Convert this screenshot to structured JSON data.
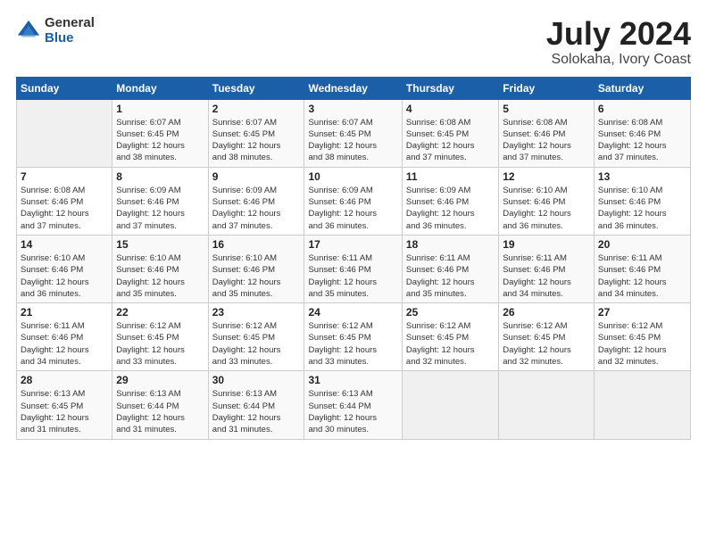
{
  "logo": {
    "general": "General",
    "blue": "Blue"
  },
  "header": {
    "title": "July 2024",
    "subtitle": "Solokaha, Ivory Coast"
  },
  "days_of_week": [
    "Sunday",
    "Monday",
    "Tuesday",
    "Wednesday",
    "Thursday",
    "Friday",
    "Saturday"
  ],
  "weeks": [
    [
      {
        "day": "",
        "info": ""
      },
      {
        "day": "1",
        "info": "Sunrise: 6:07 AM\nSunset: 6:45 PM\nDaylight: 12 hours\nand 38 minutes."
      },
      {
        "day": "2",
        "info": "Sunrise: 6:07 AM\nSunset: 6:45 PM\nDaylight: 12 hours\nand 38 minutes."
      },
      {
        "day": "3",
        "info": "Sunrise: 6:07 AM\nSunset: 6:45 PM\nDaylight: 12 hours\nand 38 minutes."
      },
      {
        "day": "4",
        "info": "Sunrise: 6:08 AM\nSunset: 6:45 PM\nDaylight: 12 hours\nand 37 minutes."
      },
      {
        "day": "5",
        "info": "Sunrise: 6:08 AM\nSunset: 6:46 PM\nDaylight: 12 hours\nand 37 minutes."
      },
      {
        "day": "6",
        "info": "Sunrise: 6:08 AM\nSunset: 6:46 PM\nDaylight: 12 hours\nand 37 minutes."
      }
    ],
    [
      {
        "day": "7",
        "info": "Sunrise: 6:08 AM\nSunset: 6:46 PM\nDaylight: 12 hours\nand 37 minutes."
      },
      {
        "day": "8",
        "info": "Sunrise: 6:09 AM\nSunset: 6:46 PM\nDaylight: 12 hours\nand 37 minutes."
      },
      {
        "day": "9",
        "info": "Sunrise: 6:09 AM\nSunset: 6:46 PM\nDaylight: 12 hours\nand 37 minutes."
      },
      {
        "day": "10",
        "info": "Sunrise: 6:09 AM\nSunset: 6:46 PM\nDaylight: 12 hours\nand 36 minutes."
      },
      {
        "day": "11",
        "info": "Sunrise: 6:09 AM\nSunset: 6:46 PM\nDaylight: 12 hours\nand 36 minutes."
      },
      {
        "day": "12",
        "info": "Sunrise: 6:10 AM\nSunset: 6:46 PM\nDaylight: 12 hours\nand 36 minutes."
      },
      {
        "day": "13",
        "info": "Sunrise: 6:10 AM\nSunset: 6:46 PM\nDaylight: 12 hours\nand 36 minutes."
      }
    ],
    [
      {
        "day": "14",
        "info": "Sunrise: 6:10 AM\nSunset: 6:46 PM\nDaylight: 12 hours\nand 36 minutes."
      },
      {
        "day": "15",
        "info": "Sunrise: 6:10 AM\nSunset: 6:46 PM\nDaylight: 12 hours\nand 35 minutes."
      },
      {
        "day": "16",
        "info": "Sunrise: 6:10 AM\nSunset: 6:46 PM\nDaylight: 12 hours\nand 35 minutes."
      },
      {
        "day": "17",
        "info": "Sunrise: 6:11 AM\nSunset: 6:46 PM\nDaylight: 12 hours\nand 35 minutes."
      },
      {
        "day": "18",
        "info": "Sunrise: 6:11 AM\nSunset: 6:46 PM\nDaylight: 12 hours\nand 35 minutes."
      },
      {
        "day": "19",
        "info": "Sunrise: 6:11 AM\nSunset: 6:46 PM\nDaylight: 12 hours\nand 34 minutes."
      },
      {
        "day": "20",
        "info": "Sunrise: 6:11 AM\nSunset: 6:46 PM\nDaylight: 12 hours\nand 34 minutes."
      }
    ],
    [
      {
        "day": "21",
        "info": "Sunrise: 6:11 AM\nSunset: 6:46 PM\nDaylight: 12 hours\nand 34 minutes."
      },
      {
        "day": "22",
        "info": "Sunrise: 6:12 AM\nSunset: 6:45 PM\nDaylight: 12 hours\nand 33 minutes."
      },
      {
        "day": "23",
        "info": "Sunrise: 6:12 AM\nSunset: 6:45 PM\nDaylight: 12 hours\nand 33 minutes."
      },
      {
        "day": "24",
        "info": "Sunrise: 6:12 AM\nSunset: 6:45 PM\nDaylight: 12 hours\nand 33 minutes."
      },
      {
        "day": "25",
        "info": "Sunrise: 6:12 AM\nSunset: 6:45 PM\nDaylight: 12 hours\nand 32 minutes."
      },
      {
        "day": "26",
        "info": "Sunrise: 6:12 AM\nSunset: 6:45 PM\nDaylight: 12 hours\nand 32 minutes."
      },
      {
        "day": "27",
        "info": "Sunrise: 6:12 AM\nSunset: 6:45 PM\nDaylight: 12 hours\nand 32 minutes."
      }
    ],
    [
      {
        "day": "28",
        "info": "Sunrise: 6:13 AM\nSunset: 6:45 PM\nDaylight: 12 hours\nand 31 minutes."
      },
      {
        "day": "29",
        "info": "Sunrise: 6:13 AM\nSunset: 6:44 PM\nDaylight: 12 hours\nand 31 minutes."
      },
      {
        "day": "30",
        "info": "Sunrise: 6:13 AM\nSunset: 6:44 PM\nDaylight: 12 hours\nand 31 minutes."
      },
      {
        "day": "31",
        "info": "Sunrise: 6:13 AM\nSunset: 6:44 PM\nDaylight: 12 hours\nand 30 minutes."
      },
      {
        "day": "",
        "info": ""
      },
      {
        "day": "",
        "info": ""
      },
      {
        "day": "",
        "info": ""
      }
    ]
  ]
}
